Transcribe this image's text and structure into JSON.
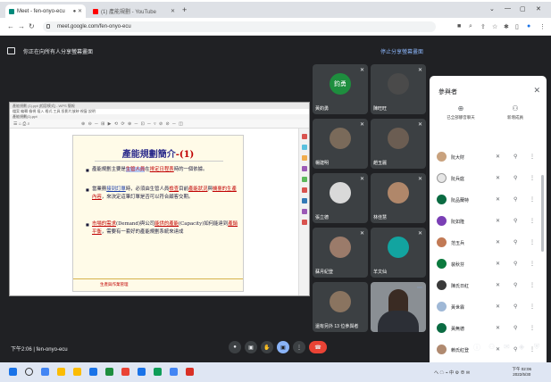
{
  "browser": {
    "tabs": [
      {
        "label": "Meet - fen-onyo-ecu"
      },
      {
        "label": "(1) 產能規劃 - YouTube"
      }
    ],
    "new_tab": "+",
    "url": "meet.google.com/fen-onyo-ecu",
    "window_controls": [
      "⌄",
      "—",
      "▢",
      "✕"
    ]
  },
  "meet": {
    "present_text": "你正在向所有人分享螢幕畫面",
    "stop_present": "停止分享螢幕畫面",
    "meeting_time": "下午2:06",
    "meeting_code": "fen-onyo-ecu",
    "participants_tiles": [
      {
        "name": "黃鈞勇",
        "avatar_text": "鈞勇",
        "avatar_color": "#1e8e3e"
      },
      {
        "name": "陳旺旺",
        "avatar_text": "",
        "avatar_color": "#4a4a4a"
      },
      {
        "name": "楊建明",
        "avatar_text": "",
        "avatar_color": "#7a6a5a"
      },
      {
        "name": "趙玉麗",
        "avatar_text": "",
        "avatar_color": "#6b5d52"
      },
      {
        "name": "張立德",
        "avatar_text": "",
        "avatar_color": "#d9d9d9"
      },
      {
        "name": "林佳慧",
        "avatar_text": "",
        "avatar_color": "#b0876a"
      },
      {
        "name": "蘇月紀登",
        "avatar_text": "",
        "avatar_color": "#9b7b6a"
      },
      {
        "name": "羊文仙",
        "avatar_text": "",
        "avatar_color": "#12a4a0"
      },
      {
        "name": "還有另外 13 位參與者",
        "avatar_text": "",
        "avatar_color": "#8a7460"
      },
      {
        "name": "",
        "avatar_text": "",
        "avatar_color": "#8a8f94"
      }
    ]
  },
  "slide": {
    "window_title": "產能規劃 (1).ppt [相容模式] - WPS 簡報",
    "menu": "檔案  編輯  檢視  插入  格式  工具  投影片放映  視窗  說明",
    "doc_tab": "產能規劃(1).ppt",
    "toolbar_left": "☰  ⌂  ⎙  ⌕",
    "toolbar_mid": "⊕ ⊖ ─ ⊞  ▶ ⟲ ⟳ ⊕ ─ ⊡ ─ ▿  ⊘ ⊘ ─ ◫",
    "title": "產能規劃簡介",
    "title_num": "-(1)",
    "b1_pre": "產能規劃主要是",
    "b1_box": "生管人員",
    "b1_mid": "在",
    "b1_blue": "排定日程表",
    "b1_post": "時的一個依據。",
    "b2_pre": "當業務",
    "b2_r1": "接到訂單",
    "b2_mid1": "時，必須由生管人員",
    "b2_r2": "檢查",
    "b2_mid2": "目前",
    "b2_r3": "產能狀況",
    "b2_mid3": "與",
    "b2_r4": "機臺的生產內容",
    "b2_post": "，來決定這筆訂單是否可以符合顧客交期。",
    "b3_r1": "市場的需求",
    "b3_mid1": "(Demand)與公司",
    "b3_r2": "能供的產能",
    "b3_mid2": "(Capacity)如何能達到",
    "b3_r3": "產銷平衡",
    "b3_post": "，需要有一套好的產能規劃系統來達成",
    "footer": "生產與作業管理"
  },
  "people_panel": {
    "title": "參與者",
    "close": "✕",
    "actions": [
      {
        "icon": "⊕",
        "label": "已全部靜音聊天"
      },
      {
        "icon": "⚇",
        "label": "新增成員"
      }
    ],
    "rows": [
      {
        "name": "阮大財",
        "color": "#c9a27e"
      },
      {
        "name": "阮兵庭",
        "color": "#e6e6e6"
      },
      {
        "name": "阮品蘭特",
        "color": "#0b6b42"
      },
      {
        "name": "阮如隆",
        "color": "#7a3fb5"
      },
      {
        "name": "范玉兵",
        "color": "#c27a55"
      },
      {
        "name": "裴秋芬",
        "color": "#0b7a3e"
      },
      {
        "name": "陳氏日紅",
        "color": "#3a3a3a"
      },
      {
        "name": "黃世霖",
        "color": "#9fb8d6"
      },
      {
        "name": "黃無德",
        "color": "#0b6b42"
      },
      {
        "name": "賴氏紅登",
        "color": "#b08a70"
      }
    ]
  },
  "taskbar": {
    "clock_time": "下午 02:06",
    "clock_date": "2022/5/30",
    "tray": "へ ☁ ⌁ 中 ⚙ ⊕ ✉",
    "apps": [
      "#1a73e8",
      "#4285f4",
      "#fbbc04",
      "#fbbc04",
      "#1a73e8",
      "#1e8e3e",
      "#ea4335",
      "#1a73e8",
      "#0f9d58",
      "#4285f4",
      "#d93025"
    ]
  }
}
